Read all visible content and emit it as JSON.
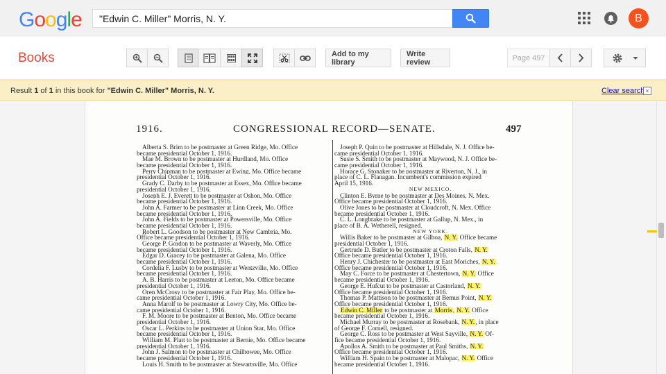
{
  "google_logo": [
    "G",
    "o",
    "o",
    "g",
    "l",
    "e"
  ],
  "logo_colors": [
    "#4285f4",
    "#ea4335",
    "#fbbc05",
    "#4285f4",
    "#34a853",
    "#ea4335"
  ],
  "search": {
    "value": "\"Edwin C. Miller\" Morris, N. Y."
  },
  "account": {
    "initial": "B",
    "color": "#f4511e"
  },
  "toolbar": {
    "title": "Books",
    "add_library": "Add to my library",
    "write_review": "Write review",
    "page_indicator": "Page 497"
  },
  "result_bar": {
    "prefix": "Result ",
    "n": "1",
    "of": " of ",
    "total": "1",
    "middle": " in this book for ",
    "query": "\"Edwin C. Miller\" Morris, N. Y.",
    "clear": "Clear search",
    "close": "×"
  },
  "page": {
    "year": "1916.",
    "title": "CONGRESSIONAL RECORD—SENATE.",
    "number": "497",
    "left_column": [
      "Alberta S. Brim to be postmaster at Green Ridge, Mo. Office",
      "became presidential October 1, 1916.",
      "Mae M. Brown to be postmaster at Hurdland, Mo. Office",
      "became presidential October 1, 1916.",
      "Perry Chipman to be postmaster at Ewing, Mo. Office became",
      "presidential October 1, 1916.",
      "Grady C. Darby to be postmaster at Essex, Mo. Office became",
      "presidential October 1, 1916.",
      "Joseph E. J. Everett to be postmaster at Oshon, Mo. Office",
      "became presidential October 1, 1916.",
      "John A. Farmer to be postmaster at Linn Creek, Mo. Office",
      "became presidential October 1, 1916.",
      "John A. Fields to be postmaster at Powersville, Mo. Office",
      "became presidential October 1, 1916.",
      "Robert L. Goodson to be postmaster at New Cambria, Mo.",
      "Office became presidential October 1, 1916.",
      "George P. Gordon to be postmaster at Waverly, Mo. Office",
      "became presidential October 1, 1916.",
      "Edgar D. Gracey to be postmaster at Galena, Mo. Office",
      "became presidential October 1, 1916.",
      "Cordelia F. Lusby to be postmaster at Wentzville, Mo. Office",
      "became presidential October 1, 1916.",
      "A. B. Harris to be postmaster at Leeton, Mo. Office became",
      "presidential October 1, 1916.",
      "Oren McCrosy to be postmaster at Fair Play, Mo. Office be-",
      "came presidential October 1, 1916.",
      "Anna Marolf to be postmaster at Lowry City, Mo. Office be-",
      "came presidential October 1, 1916.",
      "F. M. Moore to be postmaster at Benton, Mo. Office became",
      "presidential October 1, 1916.",
      "Oscar L. Perkins to be postmaster at Union Star, Mo. Office",
      "became presidential October 1, 1916.",
      "William M. Platt to be postmaster at Bernie, Mo. Office became",
      "presidential October 1, 1916.",
      "John J. Salmon to be postmaster at Chilhowee, Mo. Office",
      "became presidential October 1, 1916.",
      "Louis H. Smith to be postmaster at Stewartsville, Mo. Office"
    ],
    "right_column": [
      "Joseph P. Quin to be postmaster at Hillsdale, N. J. Office be-",
      "came presidential October 1, 1916.",
      "Susie S. Smith to be postmaster at Maywood, N. J. Office be-",
      "came presidential October 1, 1916.",
      "Horace G. Stonaker to be postmaster at Riverton, N. J., in",
      "place of C. L. Flanagan. Incumbent's commission expired",
      "April 15, 1916.",
      "NEW MEXICO.",
      "Clinton E. Byrne to be postmaster at Des Moines, N. Mex.",
      "Office became presidential October 1, 1916.",
      "Olive Jones to be postmaster at Cloudcroft, N. Mex. Office",
      "became presidential October 1, 1916.",
      "C. L. Longbrake to be postmaster at Gallup, N. Mex., in",
      "place of B. A. Wetherell, resigned.",
      "NEW YORK.",
      "Willis Baker to be postmaster at Gilboa, N. Y. Office became",
      "presidential October 1, 1916.",
      "Gertrude D. Butler to be postmaster at Croton Falls, N. Y.",
      "Office became presidential October 1, 1916.",
      "Henry J. Chichester to be postmaster at East Moriches, N. Y.",
      "Office became presidential October 1, 1916.",
      "May C. Force to be postmaster at Chestertown, N. Y. Office",
      "became presidential October 1, 1916.",
      "George E. Hufcut to be postmaster at Castorland, N. Y.",
      "Office became presidential October 1, 1916.",
      "Thomas P. Mattison to be postmaster at Bemus Point, N. Y.",
      "Office became presidential October 1, 1916.",
      "Edwin C. Miller to be postmaster at Morris, N. Y. Office",
      "became presidential October 1, 1916.",
      "Michael Murray to be postmaster at Rosebank, N. Y., in place",
      "of George F. Cornell, resigned.",
      "George C. Ross to be postmaster at West Sayville, N. Y. Of-",
      "fice became presidential October 1, 1916.",
      "Apollos A. Smith to be postmaster at Paul Smiths, N. Y.",
      "Office became presidential October 1, 1916.",
      "William H. Spain to be postmaster at Malopac, N. Y. Office",
      "became presidential October 1, 1916."
    ],
    "highlight_terms": [
      "Edwin C. Miller",
      "Morris",
      "N. Y."
    ],
    "highlight_color": "#fff36b"
  }
}
